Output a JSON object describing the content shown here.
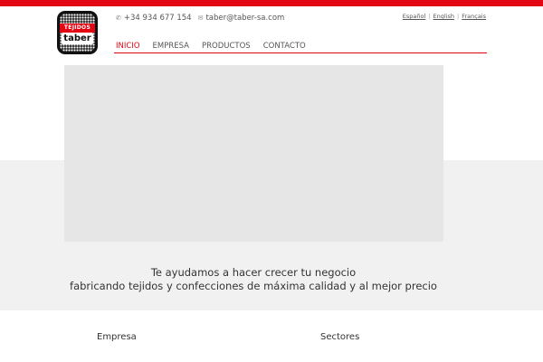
{
  "brand": {
    "accent": "#e30613",
    "logo_band_text": "TEJIDOS",
    "logo_word": "taber"
  },
  "contact": {
    "phone_icon": "phone-icon",
    "phone": "+34 934 677 154",
    "email_icon": "mail-icon",
    "email": "taber@taber-sa.com"
  },
  "languages": [
    "Español",
    "English",
    "Français"
  ],
  "nav": {
    "items": [
      "INICIO",
      "EMPRESA",
      "PRODUCTOS",
      "CONTACTO"
    ],
    "active": "INICIO"
  },
  "tagline": {
    "line1": "Te ayudamos a hacer crecer tu negocio",
    "line2": "fabricando tejidos y confecciones de máxima calidad y al mejor precio"
  },
  "footer": {
    "col1": "Empresa",
    "col2": "Sectores"
  }
}
